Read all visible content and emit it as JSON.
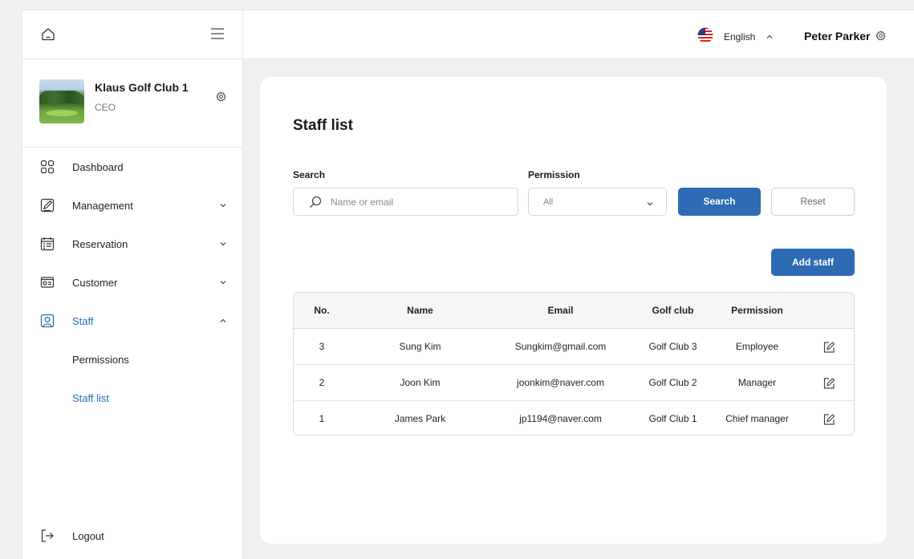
{
  "header": {
    "language": "English",
    "user_name": "Peter Parker"
  },
  "profile": {
    "club_name": "Klaus Golf Club 1",
    "role": "CEO"
  },
  "sidebar": {
    "items": [
      {
        "label": "Dashboard"
      },
      {
        "label": "Management"
      },
      {
        "label": "Reservation"
      },
      {
        "label": "Customer"
      },
      {
        "label": "Staff"
      }
    ],
    "sub_items": [
      {
        "label": "Permissions"
      },
      {
        "label": "Staff list"
      }
    ],
    "logout": "Logout"
  },
  "main": {
    "title": "Staff list",
    "search_label": "Search",
    "search_placeholder": "Name or email",
    "permission_label": "Permission",
    "permission_value": "All",
    "search_button": "Search",
    "reset_button": "Reset",
    "add_button": "Add staff",
    "table": {
      "columns": [
        "No.",
        "Name",
        "Email",
        "Golf club",
        "Permission"
      ],
      "rows": [
        {
          "no": "3",
          "name": "Sung Kim",
          "email": "Sungkim@gmail.com",
          "club": "Golf Club 3",
          "permission": "Employee"
        },
        {
          "no": "2",
          "name": "Joon Kim",
          "email": "joonkim@naver.com",
          "club": "Golf Club 2",
          "permission": "Manager"
        },
        {
          "no": "1",
          "name": "James Park",
          "email": "jp1194@naver.com",
          "club": "Golf Club 1",
          "permission": "Chief manager"
        }
      ]
    }
  },
  "colors": {
    "accent": "#2d6cb5",
    "background": "#efefef"
  }
}
